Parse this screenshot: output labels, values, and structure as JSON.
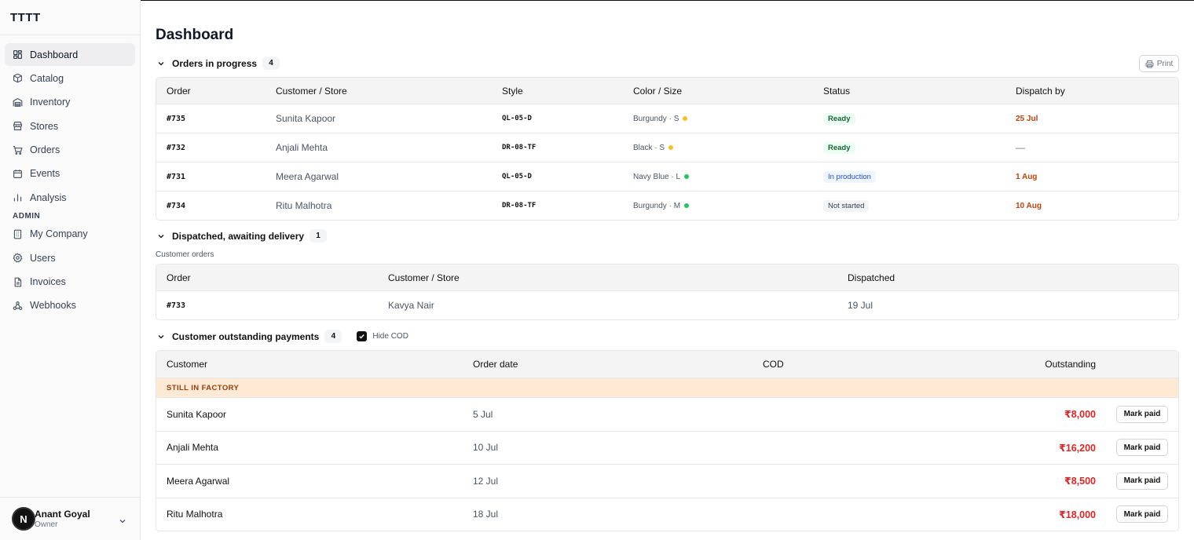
{
  "app": {
    "brand": "TTTT"
  },
  "sidebar": {
    "items": [
      {
        "label": "Dashboard",
        "icon": "dashboard-icon",
        "active": true
      },
      {
        "label": "Catalog",
        "icon": "box-icon"
      },
      {
        "label": "Inventory",
        "icon": "warehouse-icon"
      },
      {
        "label": "Stores",
        "icon": "store-icon"
      },
      {
        "label": "Orders",
        "icon": "cart-icon"
      },
      {
        "label": "Events",
        "icon": "calendar-icon"
      },
      {
        "label": "Analysis",
        "icon": "bar-chart-icon"
      }
    ],
    "admin_label": "ADMIN",
    "admin_items": [
      {
        "label": "My Company",
        "icon": "building-icon"
      },
      {
        "label": "Users",
        "icon": "gear-icon"
      },
      {
        "label": "Invoices",
        "icon": "file-icon"
      },
      {
        "label": "Webhooks",
        "icon": "webhook-icon"
      }
    ],
    "user": {
      "initial": "N",
      "name": "Anant Goyal",
      "role": "Owner"
    }
  },
  "page": {
    "title": "Dashboard",
    "print_label": "Print"
  },
  "in_progress": {
    "title": "Orders in progress",
    "count": "4",
    "headers": [
      "Order",
      "Customer / Store",
      "Style",
      "Color / Size",
      "Status",
      "Dispatch by"
    ],
    "rows": [
      {
        "order": "#735",
        "customer": "Sunita Kapoor",
        "style": "QL-05-D",
        "color_size": "Burgundy · S",
        "dot": "#fbbf24",
        "status": "Ready",
        "status_kind": "ready",
        "dispatch": "25 Jul"
      },
      {
        "order": "#732",
        "customer": "Anjali Mehta",
        "style": "DR-08-TF",
        "color_size": "Black · S",
        "dot": "#fbbf24",
        "status": "Ready",
        "status_kind": "ready",
        "dispatch": "—"
      },
      {
        "order": "#731",
        "customer": "Meera Agarwal",
        "style": "QL-05-D",
        "color_size": "Navy Blue · L",
        "dot": "#22c55e",
        "status": "In production",
        "status_kind": "prod",
        "dispatch": "1 Aug"
      },
      {
        "order": "#734",
        "customer": "Ritu Malhotra",
        "style": "DR-08-TF",
        "color_size": "Burgundy · M",
        "dot": "#22c55e",
        "status": "Not started",
        "status_kind": "not",
        "dispatch": "10 Aug"
      }
    ]
  },
  "dispatched": {
    "title": "Dispatched, awaiting delivery",
    "count": "1",
    "sub_label": "Customer orders",
    "headers": [
      "Order",
      "Customer / Store",
      "Dispatched"
    ],
    "rows": [
      {
        "order": "#733",
        "customer": "Kavya Nair",
        "dispatched": "19 Jul"
      }
    ]
  },
  "payments": {
    "title": "Customer outstanding payments",
    "count": "4",
    "hide_cod_label": "Hide COD",
    "hide_cod_checked": true,
    "headers": [
      "Customer",
      "Order date",
      "COD",
      "Outstanding"
    ],
    "group_label": "STILL IN FACTORY",
    "mark_paid_label": "Mark paid",
    "rows": [
      {
        "customer": "Sunita Kapoor",
        "date": "5 Jul",
        "cod": "",
        "outstanding": "₹8,000"
      },
      {
        "customer": "Anjali Mehta",
        "date": "10 Jul",
        "cod": "",
        "outstanding": "₹16,200"
      },
      {
        "customer": "Meera Agarwal",
        "date": "12 Jul",
        "cod": "",
        "outstanding": "₹8,500"
      },
      {
        "customer": "Ritu Malhotra",
        "date": "18 Jul",
        "cod": "",
        "outstanding": "₹18,000"
      }
    ]
  }
}
